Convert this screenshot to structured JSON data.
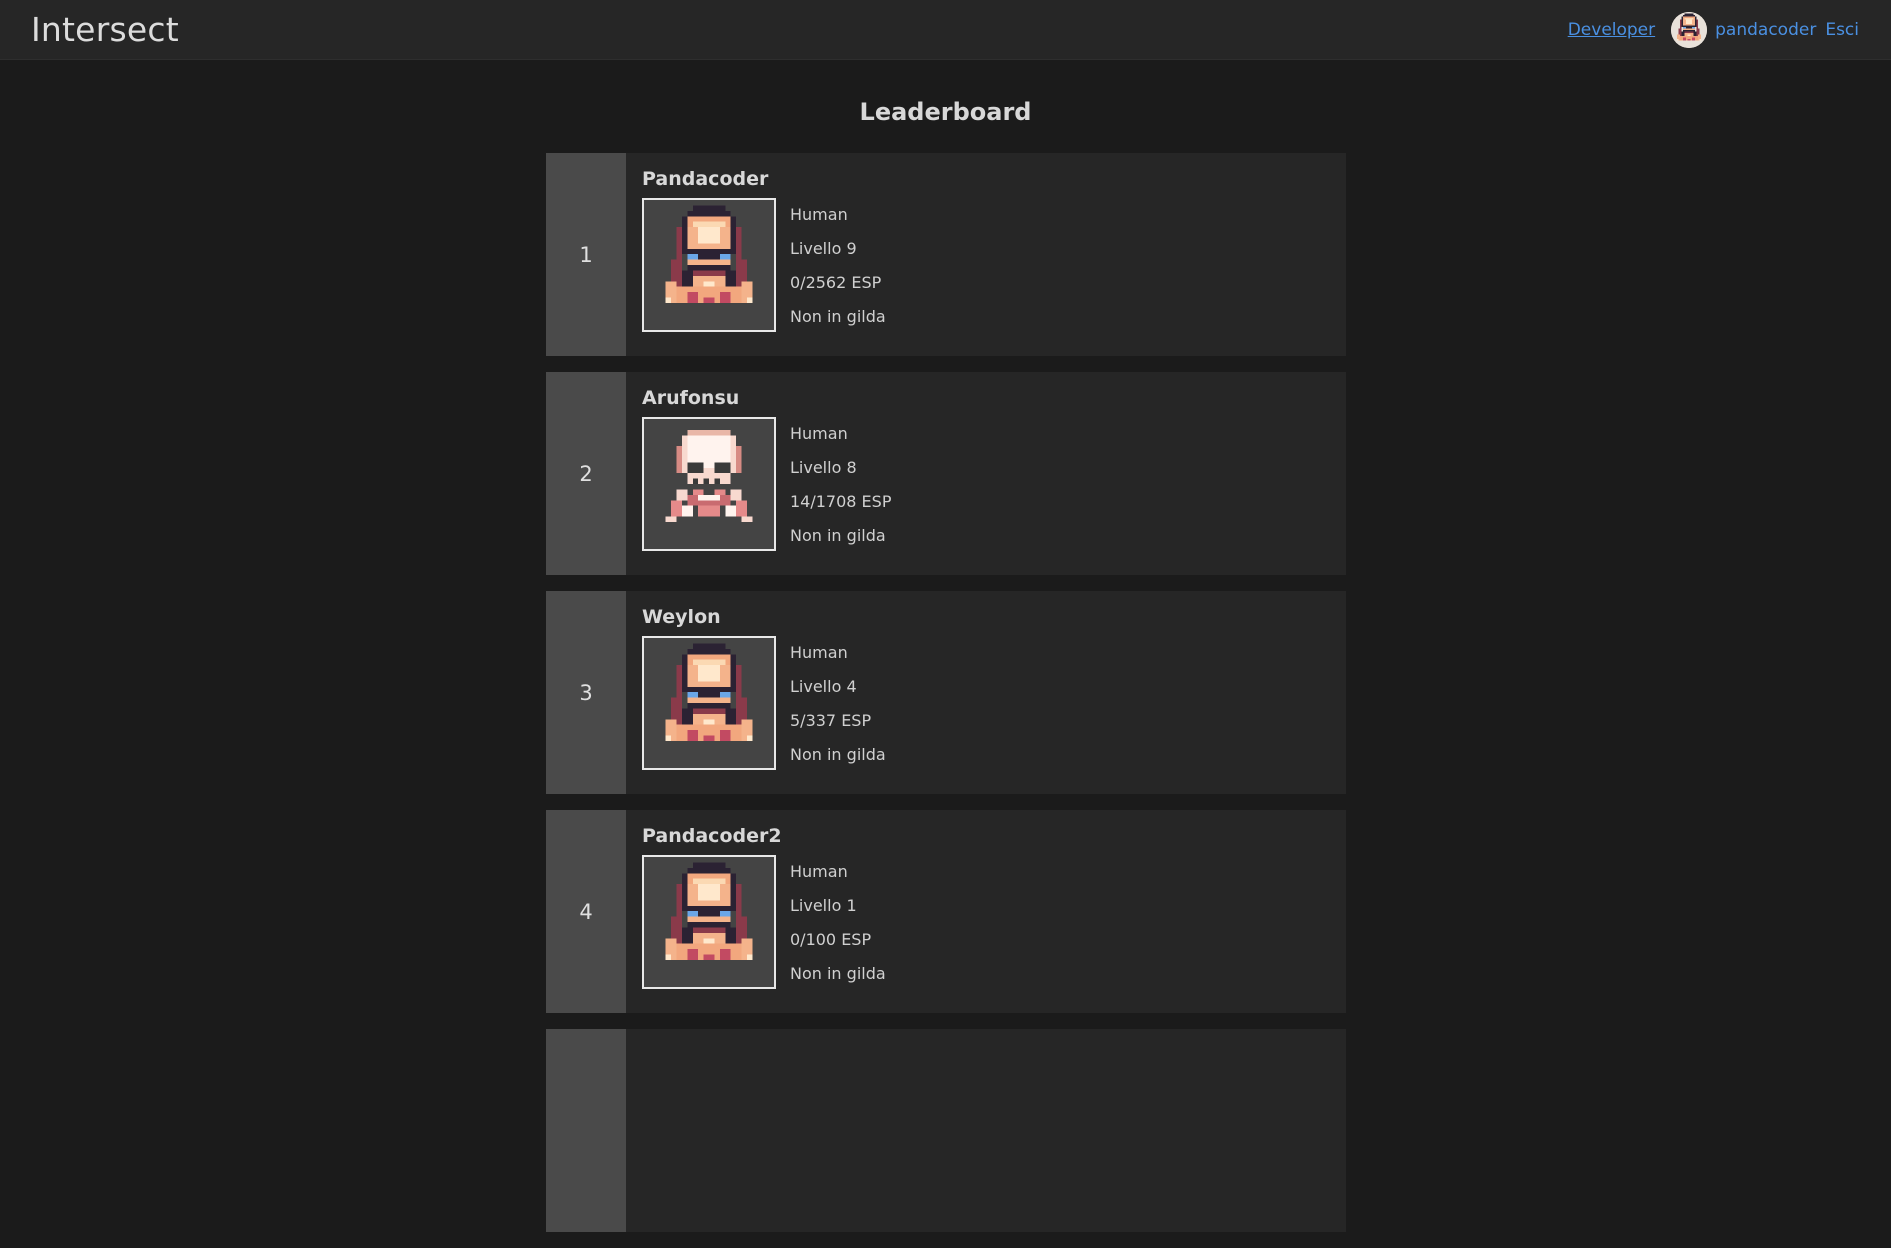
{
  "app": {
    "brand": "Intersect"
  },
  "nav": {
    "developer_link": "Developer",
    "username": "pandacoder",
    "logout": "Esci"
  },
  "page": {
    "title": "Leaderboard"
  },
  "leaderboard": [
    {
      "rank": "1",
      "name": "Pandacoder",
      "race": "Human",
      "level": "Livello 9",
      "exp": "0/2562 ESP",
      "guild": "Non in gilda",
      "portrait": "pixel-character-portrait"
    },
    {
      "rank": "2",
      "name": "Arufonsu",
      "race": "Human",
      "level": "Livello 8",
      "exp": "14/1708 ESP",
      "guild": "Non in gilda",
      "portrait": "pixel-skull-portrait"
    },
    {
      "rank": "3",
      "name": "Weylon",
      "race": "Human",
      "level": "Livello 4",
      "exp": "5/337 ESP",
      "guild": "Non in gilda",
      "portrait": "pixel-character-portrait"
    },
    {
      "rank": "4",
      "name": "Pandacoder2",
      "race": "Human",
      "level": "Livello 1",
      "exp": "0/100 ESP",
      "guild": "Non in gilda",
      "portrait": "pixel-character-portrait"
    }
  ],
  "colors": {
    "background": "#1b1b1b",
    "navbar": "#262626",
    "card": "#262626",
    "rank_cell": "#4a4a4a",
    "link": "#4a90e2"
  }
}
